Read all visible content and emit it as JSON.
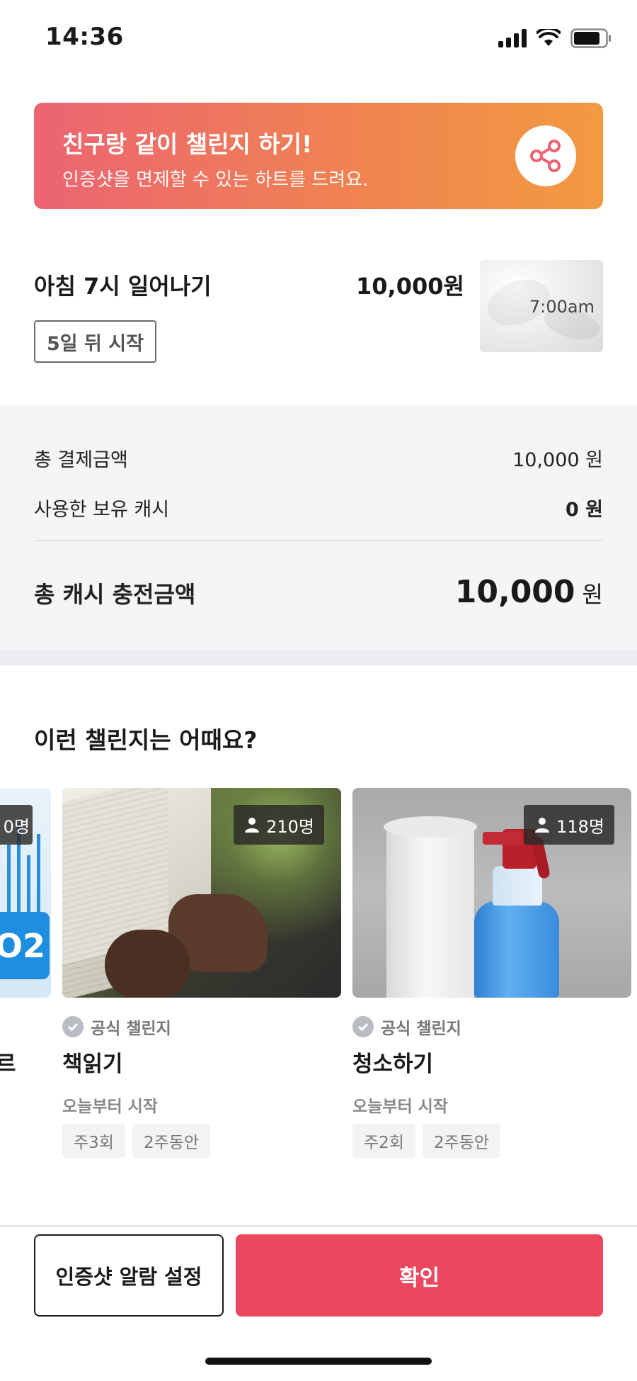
{
  "status_bar": {
    "time": "14:36"
  },
  "banner": {
    "title": "친구랑 같이 챌린지 하기!",
    "subtitle": "인증샷을 면제할 수 있는 하트를 드려요.",
    "share_icon": "share-icon"
  },
  "challenge": {
    "title": "아침 7시 일어나기",
    "price": "10,000원",
    "start_badge": "5일 뒤 시작",
    "thumb_text": "7:00am"
  },
  "payment": {
    "total_label": "총 결제금액",
    "total_value": "10,000 원",
    "cash_label": "사용한 보유 캐시",
    "cash_value": "0 원",
    "charge_label": "총 캐시 충전금액",
    "charge_amount": "10,000",
    "charge_unit": "원"
  },
  "recommendations": {
    "title": "이런 챌린지는 어때요?",
    "partial_card": {
      "count": "0명",
      "name_fragment": "르"
    },
    "cards": [
      {
        "count": "210명",
        "official_label": "공식 챌린지",
        "name": "책읽기",
        "start": "오늘부터 시작",
        "chips": [
          "주3회",
          "2주동안"
        ]
      },
      {
        "count": "118명",
        "official_label": "공식 챌린지",
        "name": "청소하기",
        "start": "오늘부터 시작",
        "chips": [
          "주2회",
          "2주동안"
        ]
      }
    ]
  },
  "footer": {
    "alarm_button": "인증샷 알람 설정",
    "confirm_button": "확인"
  },
  "colors": {
    "accent": "#e9485e",
    "banner_start": "#ec6472",
    "banner_end": "#f29a42"
  }
}
